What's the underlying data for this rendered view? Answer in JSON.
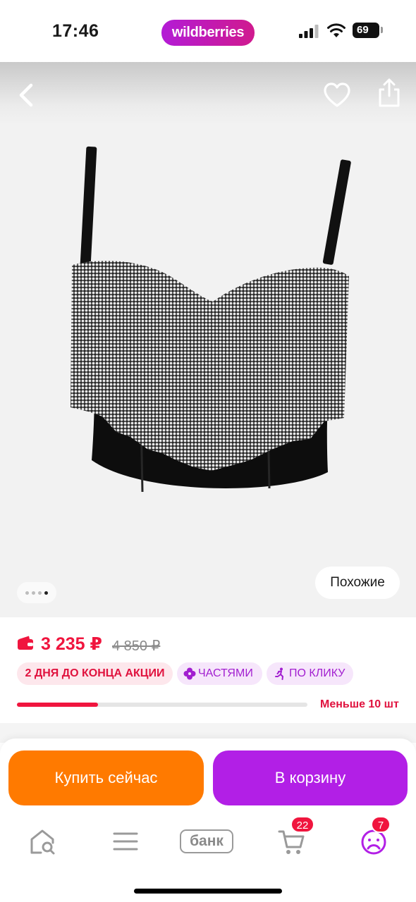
{
  "status_bar": {
    "time": "17:46",
    "brand": "wildberries",
    "battery": "69",
    "icons": [
      "signal-icon",
      "wifi-icon",
      "battery-icon"
    ]
  },
  "gallery": {
    "icons": [
      "back-arrow-icon",
      "heart-icon",
      "share-icon"
    ],
    "product_image": "black bustier crop top with rhinestone fringe",
    "image_count": 4,
    "active_image": 4,
    "similar_label": "Похожие"
  },
  "price": {
    "current": "3 235 ₽",
    "old": "4 850 ₽",
    "wallet_icon": "wallet-icon",
    "accent_color": "#f0153e"
  },
  "badges": {
    "promo": "2 ДНЯ ДО КОНЦА АКЦИИ",
    "parts": "ЧАСТЯМИ",
    "parts_icon": "clover-icon",
    "click": "ПО КЛИКУ",
    "click_icon": "running-person-icon"
  },
  "stock": {
    "label": "Меньше 10 шт",
    "fill_fraction": 0.28
  },
  "actions": {
    "buy_now": "Купить сейчас",
    "buy_now_color": "#ff7a00",
    "add_to_cart": "В корзину",
    "add_to_cart_color": "#b21fe6"
  },
  "tab_bar": {
    "home_icon": "home-search-icon",
    "catalog_icon": "menu-icon",
    "bank_label": "банк",
    "basket_icon": "cart-icon",
    "basket_count": "22",
    "profile_icon": "profile-face-icon",
    "profile_count": "7"
  }
}
